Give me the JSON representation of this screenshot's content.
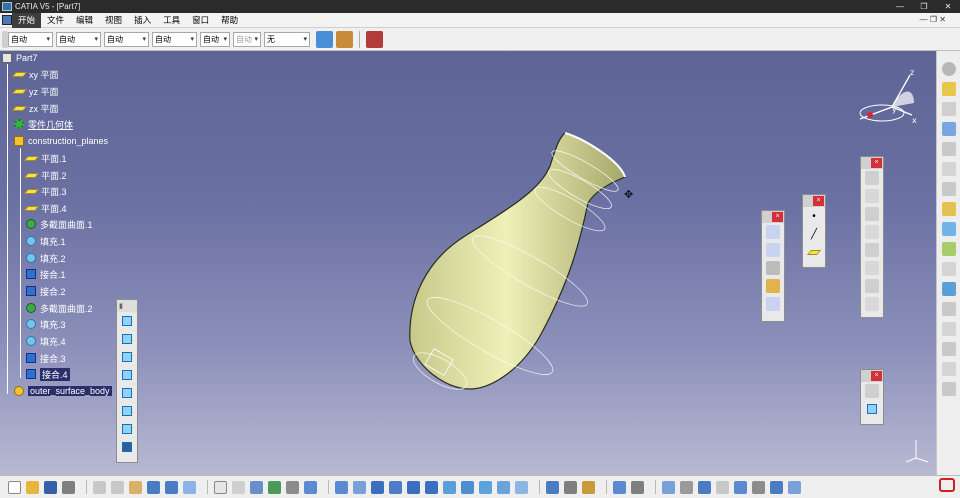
{
  "window": {
    "title": "CATIA V5 - [Part7]"
  },
  "menu": [
    "开始",
    "文件",
    "编辑",
    "视图",
    "插入",
    "工具",
    "窗口",
    "帮助"
  ],
  "toolbar": {
    "selects": [
      {
        "value": "自动",
        "disabled": false
      },
      {
        "value": "自动",
        "disabled": false
      },
      {
        "value": "自动",
        "disabled": false
      },
      {
        "value": "自动",
        "disabled": false
      },
      {
        "value": "自动",
        "disabled": false
      },
      {
        "value": "自动",
        "disabled": true
      },
      {
        "value": "无",
        "disabled": false
      }
    ]
  },
  "tree": {
    "root": "Part7",
    "items": [
      {
        "label": "xy 平面",
        "icon": "plane-icon"
      },
      {
        "label": "yz 平面",
        "icon": "plane-icon"
      },
      {
        "label": "zx 平面",
        "icon": "plane-icon"
      },
      {
        "label": "零件几何体",
        "icon": "part-body-gear-icon",
        "underline": true
      },
      {
        "label": "construction_planes",
        "icon": "geometric-set-icon"
      },
      {
        "label": "平面.1",
        "icon": "plane-icon"
      },
      {
        "label": "平面.2",
        "icon": "plane-icon"
      },
      {
        "label": "平面.3",
        "icon": "plane-icon"
      },
      {
        "label": "平面.4",
        "icon": "plane-icon"
      },
      {
        "label": "多截面曲面.1",
        "icon": "multi-section-surface-icon"
      },
      {
        "label": "填充.1",
        "icon": "fill-surface-icon"
      },
      {
        "label": "填充.2",
        "icon": "fill-surface-icon"
      },
      {
        "label": "接合.1",
        "icon": "join-icon"
      },
      {
        "label": "接合.2",
        "icon": "join-icon"
      },
      {
        "label": "多截面曲面.2",
        "icon": "multi-section-surface-icon"
      },
      {
        "label": "填充.3",
        "icon": "fill-surface-icon"
      },
      {
        "label": "填充.4",
        "icon": "fill-surface-icon"
      },
      {
        "label": "接合.3",
        "icon": "join-icon"
      },
      {
        "label": "接合.4",
        "icon": "join-icon"
      },
      {
        "label": "outer_surface_body",
        "icon": "geometric-set-icon"
      }
    ]
  },
  "colors": {
    "viewport_top": "#5f6496",
    "viewport_bottom": "#b8b9d3",
    "model_fill": "#e6e8a8",
    "selection": "#2a2f6a"
  }
}
